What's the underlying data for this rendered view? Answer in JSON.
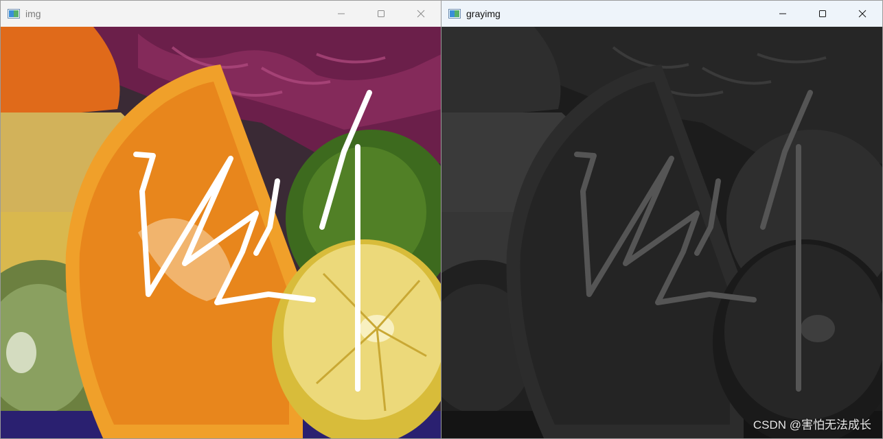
{
  "windows": [
    {
      "title": "img",
      "active": false,
      "content": "color photograph of sliced fruits: orange wedge, red cabbage, lime, lemon half, kiwi and bananas, with white freehand strokes drawn over it"
    },
    {
      "title": "grayimg",
      "active": true,
      "content": "the same picture shown in dark grayscale with gray freehand strokes"
    }
  ],
  "controls": {
    "minimize": "minimize-icon",
    "maximize": "maximize-icon",
    "close": "close-icon"
  },
  "watermark": "CSDN @害怕无法成长",
  "colors": {
    "inactive_titlebar": "#f3f3f3",
    "active_titlebar": "#eef4fa",
    "stroke_color_img": "#ffffff",
    "stroke_color_gray": "#555555"
  }
}
